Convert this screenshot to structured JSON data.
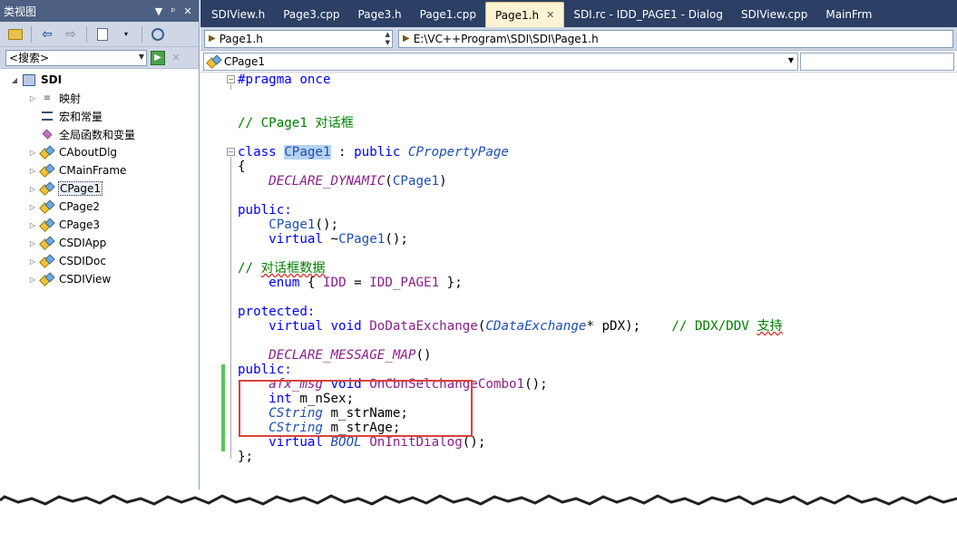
{
  "class_view": {
    "title": "类视图",
    "controls": [
      "▼",
      "ᵖ",
      "✕"
    ],
    "search": {
      "placeholder": "<搜索>"
    },
    "tree": [
      {
        "label": "SDI",
        "kind": "project",
        "level": 0,
        "expander": "◢",
        "bold": true
      },
      {
        "label": "映射",
        "kind": "map",
        "level": 1,
        "expander": "▷"
      },
      {
        "label": "宏和常量",
        "kind": "macro",
        "level": 1,
        "expander": ""
      },
      {
        "label": "全局函数和变量",
        "kind": "global",
        "level": 1,
        "expander": ""
      },
      {
        "label": "CAboutDlg",
        "kind": "class",
        "level": 1,
        "expander": "▷"
      },
      {
        "label": "CMainFrame",
        "kind": "class",
        "level": 1,
        "expander": "▷"
      },
      {
        "label": "CPage1",
        "kind": "class",
        "level": 1,
        "expander": "▷",
        "selected": true
      },
      {
        "label": "CPage2",
        "kind": "class",
        "level": 1,
        "expander": "▷"
      },
      {
        "label": "CPage3",
        "kind": "class",
        "level": 1,
        "expander": "▷"
      },
      {
        "label": "CSDIApp",
        "kind": "class",
        "level": 1,
        "expander": "▷"
      },
      {
        "label": "CSDIDoc",
        "kind": "class",
        "level": 1,
        "expander": "▷"
      },
      {
        "label": "CSDIView",
        "kind": "class",
        "level": 1,
        "expander": "▷"
      }
    ]
  },
  "tabs": [
    {
      "label": "SDIView.h"
    },
    {
      "label": "Page3.cpp"
    },
    {
      "label": "Page3.h"
    },
    {
      "label": "Page1.cpp"
    },
    {
      "label": "Page1.h",
      "active": true
    },
    {
      "label": "SDI.rc - IDD_PAGE1 - Dialog"
    },
    {
      "label": "SDIView.cpp"
    },
    {
      "label": "MainFrm"
    }
  ],
  "navbar": {
    "file": "Page1.h",
    "path": "E:\\VC++Program\\SDI\\SDI\\Page1.h",
    "class_combo": "CPage1"
  },
  "code_lines": [
    [
      [
        "#pragma once",
        "kw"
      ]
    ],
    [],
    [],
    [
      [
        "// CPage1 对话框",
        "cm"
      ]
    ],
    [],
    [
      [
        "class ",
        "kw"
      ],
      [
        "CPage1",
        "hlcls"
      ],
      [
        " : ",
        ""
      ],
      [
        "public ",
        "kw"
      ],
      [
        "CPropertyPage",
        "type"
      ]
    ],
    [
      [
        "{",
        ""
      ]
    ],
    [
      [
        "    ",
        ""
      ],
      [
        "DECLARE_DYNAMIC",
        "mac"
      ],
      [
        "(",
        ""
      ],
      [
        "CPage1",
        "cls"
      ],
      [
        ")",
        ""
      ]
    ],
    [],
    [
      [
        "public:",
        "kw"
      ]
    ],
    [
      [
        "    ",
        ""
      ],
      [
        "CPage1",
        "cls"
      ],
      [
        "();",
        ""
      ]
    ],
    [
      [
        "    ",
        ""
      ],
      [
        "virtual ",
        "kw"
      ],
      [
        "~",
        ""
      ],
      [
        "CPage1",
        "cls"
      ],
      [
        "();",
        ""
      ]
    ],
    [],
    [
      [
        "// ",
        "cm"
      ],
      [
        "对话框数据",
        "cmsq"
      ]
    ],
    [
      [
        "    ",
        ""
      ],
      [
        "enum ",
        "kw"
      ],
      [
        "{ ",
        ""
      ],
      [
        "IDD",
        "mac2"
      ],
      [
        " = ",
        ""
      ],
      [
        "IDD_PAGE1",
        "mac2"
      ],
      [
        " };",
        ""
      ]
    ],
    [],
    [
      [
        "protected:",
        "kw"
      ]
    ],
    [
      [
        "    ",
        ""
      ],
      [
        "virtual ",
        "kw"
      ],
      [
        "void ",
        "kw"
      ],
      [
        "DoDataExchange",
        "mac2"
      ],
      [
        "(",
        ""
      ],
      [
        "CDataExchange",
        "type"
      ],
      [
        "* pDX);    ",
        ""
      ],
      [
        "// DDX/DDV ",
        "cm"
      ],
      [
        "支持",
        "cmsq"
      ]
    ],
    [],
    [
      [
        "    ",
        ""
      ],
      [
        "DECLARE_MESSAGE_MAP",
        "mac"
      ],
      [
        "()",
        ""
      ]
    ],
    [
      [
        "public:",
        "kw"
      ]
    ],
    [
      [
        "    ",
        ""
      ],
      [
        "afx_msg",
        "mac"
      ],
      [
        " ",
        ""
      ],
      [
        "void ",
        "kw"
      ],
      [
        "OnCbnSelchangeCombo1",
        "mac2"
      ],
      [
        "();",
        ""
      ]
    ],
    [
      [
        "    ",
        ""
      ],
      [
        "int ",
        "kw"
      ],
      [
        "m_nSex;",
        ""
      ]
    ],
    [
      [
        "    ",
        ""
      ],
      [
        "CString",
        "type"
      ],
      [
        " m_strName;",
        ""
      ]
    ],
    [
      [
        "    ",
        ""
      ],
      [
        "CString",
        "type"
      ],
      [
        " m_strAge;",
        ""
      ]
    ],
    [
      [
        "    ",
        ""
      ],
      [
        "virtual ",
        "kw"
      ],
      [
        "BOOL",
        "type"
      ],
      [
        " ",
        ""
      ],
      [
        "OnInitDialog",
        "mac2"
      ],
      [
        "();",
        ""
      ]
    ],
    [
      [
        "};",
        ""
      ]
    ]
  ]
}
